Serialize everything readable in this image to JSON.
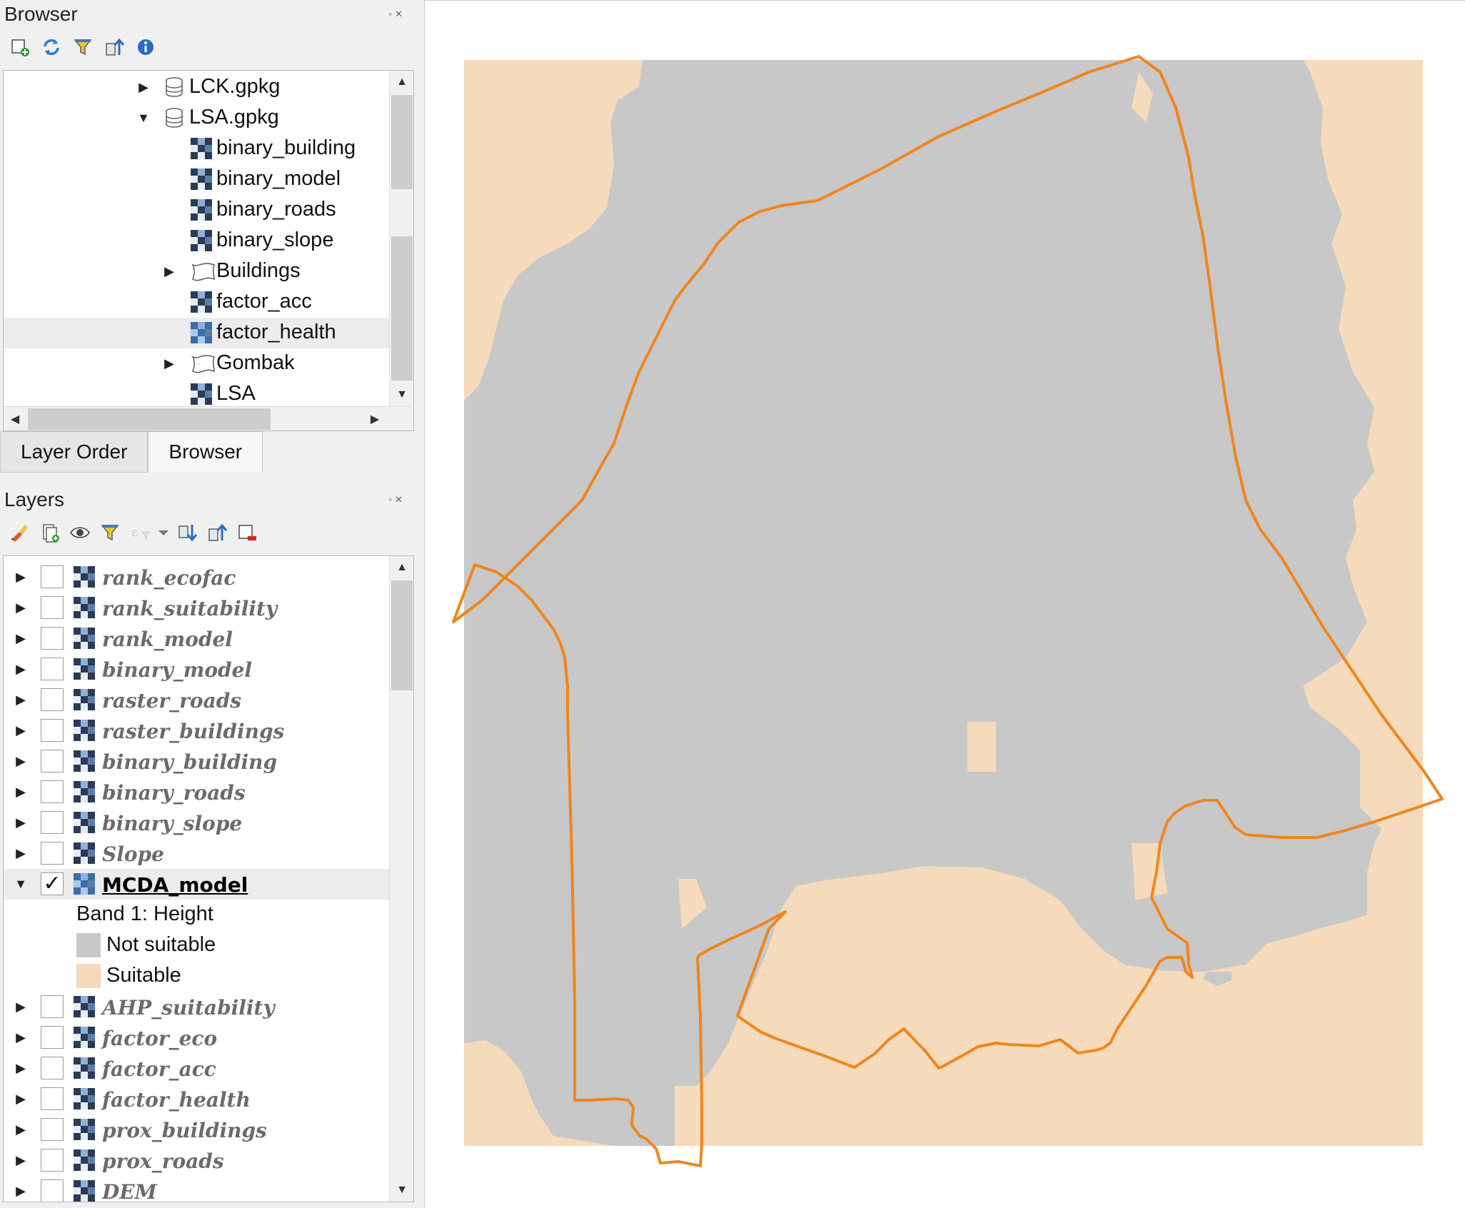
{
  "browser_panel": {
    "title": "Browser",
    "toolbar": [
      "add-layer-icon",
      "refresh-icon",
      "filter-icon",
      "collapse-all-icon",
      "info-icon"
    ],
    "items": [
      {
        "label": "LCK.gpkg",
        "icon": "database-icon",
        "expander": "collapsed"
      },
      {
        "label": "LSA.gpkg",
        "icon": "database-icon",
        "expander": "expanded"
      },
      {
        "label": "binary_building",
        "icon": "raster-icon"
      },
      {
        "label": "binary_model",
        "icon": "raster-icon"
      },
      {
        "label": "binary_roads",
        "icon": "raster-icon"
      },
      {
        "label": "binary_slope",
        "icon": "raster-icon"
      },
      {
        "label": "Buildings",
        "icon": "polygon-layer-icon",
        "expander": "collapsed"
      },
      {
        "label": "factor_acc",
        "icon": "raster-icon"
      },
      {
        "label": "factor_health",
        "icon": "raster-icon",
        "selected": true
      },
      {
        "label": "Gombak",
        "icon": "polygon-layer-icon",
        "expander": "collapsed"
      },
      {
        "label": "LSA",
        "icon": "raster-icon"
      }
    ]
  },
  "tabs": [
    {
      "label": "Layer Order",
      "active": false
    },
    {
      "label": "Browser",
      "active": true
    }
  ],
  "layers_panel": {
    "title": "Layers",
    "toolbar": [
      "style-manager-icon",
      "add-group-icon",
      "manage-visibility-icon",
      "filter-legend-icon",
      "filter-expression-icon",
      "expand-all-icon",
      "collapse-all-icon",
      "remove-layer-icon"
    ],
    "layers": [
      {
        "label": "rank_ecofac",
        "checked": false
      },
      {
        "label": "rank_suitability",
        "checked": false
      },
      {
        "label": "rank_model",
        "checked": false
      },
      {
        "label": "binary_model",
        "checked": false
      },
      {
        "label": "raster_roads",
        "checked": false
      },
      {
        "label": "raster_buildings",
        "checked": false
      },
      {
        "label": "binary_building",
        "checked": false
      },
      {
        "label": "binary_roads",
        "checked": false
      },
      {
        "label": "binary_slope",
        "checked": false
      },
      {
        "label": "Slope",
        "checked": false
      },
      {
        "label": "MCDA_model",
        "checked": true,
        "expanded": true,
        "legend": {
          "band": "Band 1: Height",
          "classes": [
            {
              "label": "Not suitable",
              "color": "#c8c8c8"
            },
            {
              "label": "Suitable",
              "color": "#f5dbbb"
            }
          ]
        }
      },
      {
        "label": "AHP_suitability",
        "checked": false
      },
      {
        "label": "factor_eco",
        "checked": false
      },
      {
        "label": "factor_acc",
        "checked": false
      },
      {
        "label": "factor_health",
        "checked": false
      },
      {
        "label": "prox_buildings",
        "checked": false
      },
      {
        "label": "prox_roads",
        "checked": false
      },
      {
        "label": "DEM",
        "checked": false
      }
    ]
  },
  "map": {
    "colors": {
      "not_suitable": "#c8c8c8",
      "suitable": "#f5dbbb",
      "boundary": "#f0861e",
      "background": "#ffffff"
    }
  }
}
